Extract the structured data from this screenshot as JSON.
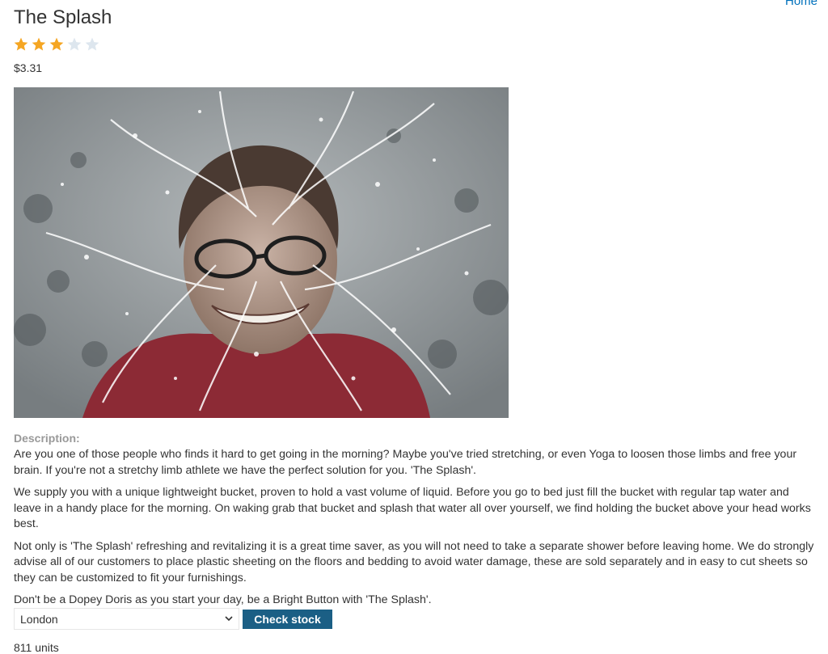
{
  "nav": {
    "home_label": "Home"
  },
  "product": {
    "title": "The Splash",
    "rating": {
      "value": 3,
      "max": 5,
      "filled_color": "#f5a623",
      "empty_color": "#dde6ee"
    },
    "price": "$3.31",
    "image": {
      "description": "woman being splashed with water in the face",
      "icon": "product-photo"
    },
    "description_label": "Description:",
    "description_paragraphs": [
      "Are you one of those people who finds it hard to get going in the morning? Maybe you've tried stretching, or even Yoga to loosen those limbs and free your brain. If you're not a stretchy limb athlete we have the perfect solution for you. 'The Splash'.",
      "We supply you with a unique lightweight bucket, proven to hold a vast volume of liquid. Before you go to bed just fill the bucket with regular tap water and leave in a handy place for the morning. On waking grab that bucket and splash that water all over yourself, we find holding the bucket above your head works best.",
      "Not only is 'The Splash' refreshing and revitalizing it is a great time saver, as you will not need to take a separate shower before leaving home. We do strongly advise all of our customers to place plastic sheeting on the floors and bedding to avoid water damage, these are sold separately and in easy to cut sheets so they can be customized to fit your furnishings.",
      "Don't be a Dopey Doris as you start your day, be a Bright Button with 'The Splash'."
    ]
  },
  "stock_check": {
    "selected_store": "London",
    "button_label": "Check stock",
    "result": "811 units",
    "button_color": "#1b5f85"
  }
}
